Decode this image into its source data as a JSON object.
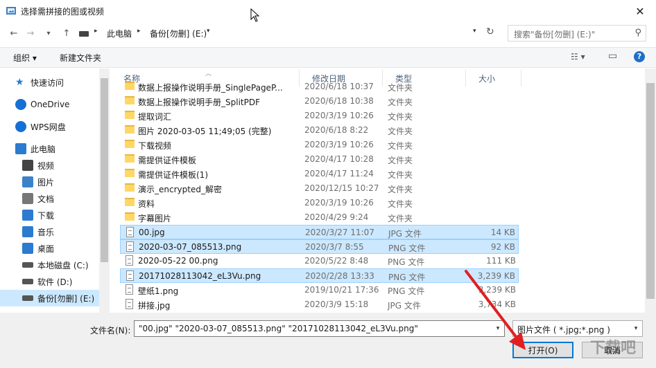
{
  "window": {
    "title": "选择需拼接的图或视频",
    "close_glyph": "✕"
  },
  "nav": {
    "back": "←",
    "forward": "→",
    "recent": "▾",
    "up": "↑",
    "breadcrumb": [
      "此电脑",
      "备份[勿删] (E:)"
    ],
    "crumb_sep": "▸",
    "dropdown": "▾",
    "refresh": "↻",
    "search_placeholder": "搜索\"备份[勿删] (E:)\"",
    "search_glyph": "⚲"
  },
  "toolbar": {
    "organize": "组织 ▾",
    "new_folder": "新建文件夹",
    "view_icon_glyph": "☷ ▾",
    "pane_glyph": "▭",
    "help_glyph": "?"
  },
  "sidebar": {
    "items": [
      {
        "label": "快速访问",
        "icon": "star-icon",
        "color": "#1f7ad9"
      },
      {
        "label": "OneDrive",
        "icon": "cloud-icon",
        "color": "#1570d6"
      },
      {
        "label": "WPS网盘",
        "icon": "cloud-icon",
        "color": "#1570d6"
      },
      {
        "label": "此电脑",
        "icon": "computer-icon",
        "color": "#2b7bd0"
      },
      {
        "label": "视频",
        "icon": "video-icon",
        "color": "#444"
      },
      {
        "label": "图片",
        "icon": "picture-icon",
        "color": "#3b83c9"
      },
      {
        "label": "文档",
        "icon": "document-icon",
        "color": "#777"
      },
      {
        "label": "下载",
        "icon": "download-icon",
        "color": "#2b7bd0"
      },
      {
        "label": "音乐",
        "icon": "music-icon",
        "color": "#2b7bd0"
      },
      {
        "label": "桌面",
        "icon": "desktop-icon",
        "color": "#2b7bd0"
      },
      {
        "label": "本地磁盘 (C:)",
        "icon": "drive-icon",
        "color": "#555"
      },
      {
        "label": "软件 (D:)",
        "icon": "drive-icon",
        "color": "#555"
      },
      {
        "label": "备份[勿删] (E:)",
        "icon": "drive-icon",
        "color": "#555"
      }
    ]
  },
  "columns": {
    "name": "名称",
    "modified": "修改日期",
    "type": "类型",
    "size": "大小"
  },
  "files": [
    {
      "name": "数据上报操作说明手册_SinglePageP...",
      "date": "2020/6/18 10:37",
      "type": "文件夹",
      "size": "",
      "kind": "folder",
      "selected": false
    },
    {
      "name": "数据上报操作说明手册_SplitPDF",
      "date": "2020/6/18 10:38",
      "type": "文件夹",
      "size": "",
      "kind": "folder",
      "selected": false
    },
    {
      "name": "提取词汇",
      "date": "2020/3/19 10:26",
      "type": "文件夹",
      "size": "",
      "kind": "folder",
      "selected": false
    },
    {
      "name": "图片 2020-03-05 11;49;05 (完整)",
      "date": "2020/6/18 8:22",
      "type": "文件夹",
      "size": "",
      "kind": "folder",
      "selected": false
    },
    {
      "name": "下载视频",
      "date": "2020/3/19 10:26",
      "type": "文件夹",
      "size": "",
      "kind": "folder",
      "selected": false
    },
    {
      "name": "需提供证件模板",
      "date": "2020/4/17 10:28",
      "type": "文件夹",
      "size": "",
      "kind": "folder",
      "selected": false
    },
    {
      "name": "需提供证件模板(1)",
      "date": "2020/4/17 11:24",
      "type": "文件夹",
      "size": "",
      "kind": "folder",
      "selected": false
    },
    {
      "name": "演示_encrypted_解密",
      "date": "2020/12/15 10:27",
      "type": "文件夹",
      "size": "",
      "kind": "folder",
      "selected": false
    },
    {
      "name": "资料",
      "date": "2020/3/19 10:26",
      "type": "文件夹",
      "size": "",
      "kind": "folder",
      "selected": false
    },
    {
      "name": "字幕图片",
      "date": "2020/4/29 9:24",
      "type": "文件夹",
      "size": "",
      "kind": "folder",
      "selected": false
    },
    {
      "name": "00.jpg",
      "date": "2020/3/27 11:07",
      "type": "JPG 文件",
      "size": "14 KB",
      "kind": "file",
      "selected": true
    },
    {
      "name": "2020-03-07_085513.png",
      "date": "2020/3/7 8:55",
      "type": "PNG 文件",
      "size": "92 KB",
      "kind": "file",
      "selected": true
    },
    {
      "name": "2020-05-22 00.png",
      "date": "2020/5/22 8:48",
      "type": "PNG 文件",
      "size": "111 KB",
      "kind": "file",
      "selected": false
    },
    {
      "name": "20171028113042_eL3Vu.png",
      "date": "2020/2/28 13:33",
      "type": "PNG 文件",
      "size": "3,239 KB",
      "kind": "file",
      "selected": true
    },
    {
      "name": "壁纸1.png",
      "date": "2019/10/21 17:36",
      "type": "PNG 文件",
      "size": "3,239 KB",
      "kind": "file",
      "selected": false
    },
    {
      "name": "拼接.jpg",
      "date": "2020/3/9 15:18",
      "type": "JPG 文件",
      "size": "3,734 KB",
      "kind": "file",
      "selected": false
    }
  ],
  "bottom": {
    "filename_label": "文件名(N):",
    "filename_value": "\"00.jpg\" \"2020-03-07_085513.png\" \"20171028113042_eL3Vu.png\"",
    "filetype_value": "图片文件 ( *.jpg;*.png )",
    "open_label": "打开(O)",
    "cancel_label": "取消",
    "dropdown_glyph": "▾"
  },
  "colors": {
    "selection": "#cce8ff",
    "selection_border": "#99d1ff",
    "accent": "#0078d7",
    "folder": "#ffd766",
    "arrow": "#e02020"
  }
}
